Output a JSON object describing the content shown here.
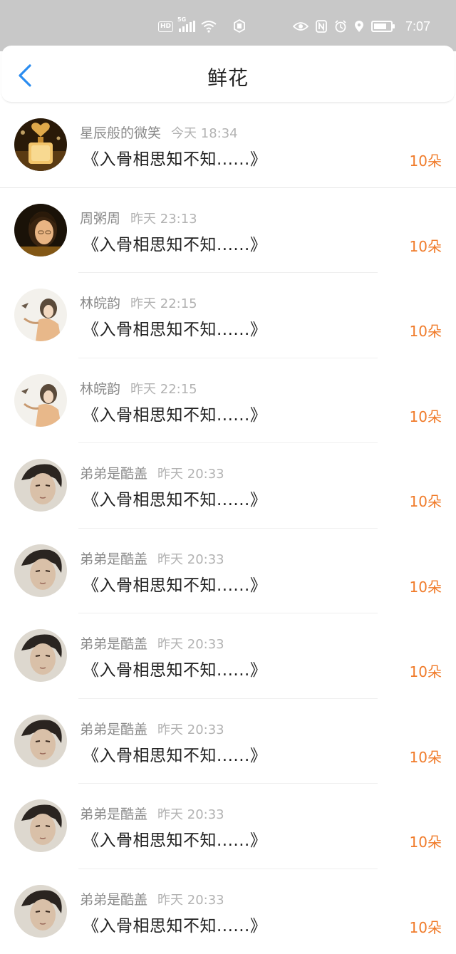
{
  "status_bar": {
    "time": "7:07",
    "hd": "HD",
    "network": "5G",
    "left_icons": [
      "hd-icon",
      "signal-icon",
      "wifi-icon",
      "app-notification-icon"
    ],
    "right_icons": [
      "eye-icon",
      "nfc-icon",
      "alarm-icon",
      "location-icon",
      "battery-icon"
    ]
  },
  "header": {
    "title": "鲜花",
    "back_icon": "chevron-left-icon",
    "accent": "#2a8cf0"
  },
  "colors": {
    "count": "#f07b2a",
    "name": "#8a8a8a",
    "time": "#b2b2b2",
    "message": "#222222"
  },
  "items": [
    {
      "name": "星辰般的微笑",
      "time": "今天 18:34",
      "message": "《入骨相思知不知......》",
      "count": "10朵",
      "avatar": "perfume-bottle-avatar"
    },
    {
      "name": "周粥周",
      "time": "昨天 23:13",
      "message": "《入骨相思知不知......》",
      "count": "10朵",
      "avatar": "woman-portrait-avatar"
    },
    {
      "name": "林皖韵",
      "time": "昨天 22:15",
      "message": "《入骨相思知不知......》",
      "count": "10朵",
      "avatar": "ancient-lady-avatar"
    },
    {
      "name": "林皖韵",
      "time": "昨天 22:15",
      "message": "《入骨相思知不知......》",
      "count": "10朵",
      "avatar": "ancient-lady-avatar"
    },
    {
      "name": "弟弟是酷盖",
      "time": "昨天 20:33",
      "message": "《入骨相思知不知......》",
      "count": "10朵",
      "avatar": "man-portrait-avatar"
    },
    {
      "name": "弟弟是酷盖",
      "time": "昨天 20:33",
      "message": "《入骨相思知不知......》",
      "count": "10朵",
      "avatar": "man-portrait-avatar"
    },
    {
      "name": "弟弟是酷盖",
      "time": "昨天 20:33",
      "message": "《入骨相思知不知......》",
      "count": "10朵",
      "avatar": "man-portrait-avatar"
    },
    {
      "name": "弟弟是酷盖",
      "time": "昨天 20:33",
      "message": "《入骨相思知不知......》",
      "count": "10朵",
      "avatar": "man-portrait-avatar"
    },
    {
      "name": "弟弟是酷盖",
      "time": "昨天 20:33",
      "message": "《入骨相思知不知......》",
      "count": "10朵",
      "avatar": "man-portrait-avatar"
    },
    {
      "name": "弟弟是酷盖",
      "time": "昨天 20:33",
      "message": "《入骨相思知不知......》",
      "count": "10朵",
      "avatar": "man-portrait-avatar"
    }
  ]
}
